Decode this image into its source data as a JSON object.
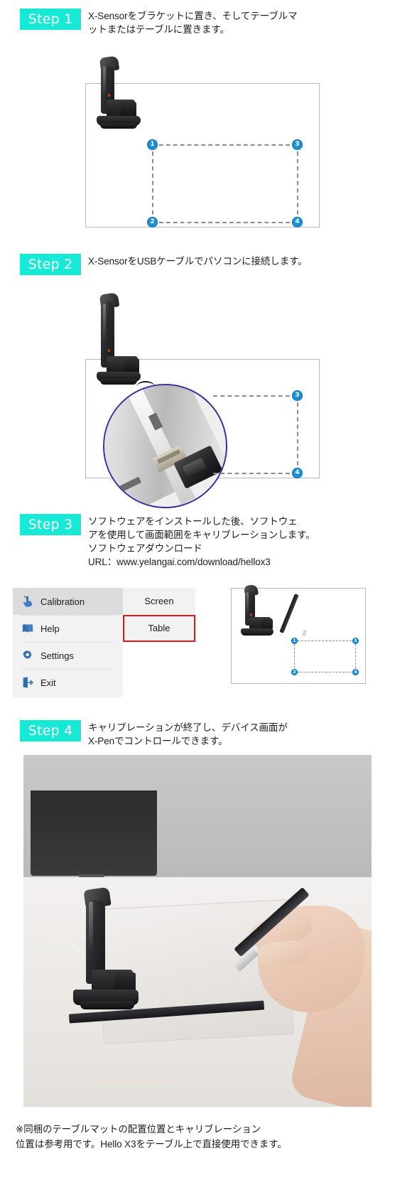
{
  "steps": [
    {
      "badge": "Step 1",
      "lines": [
        "X-Sensorをブラケットに置き、そしてテーブルマ",
        "ットまたはテーブルに置きます。"
      ]
    },
    {
      "badge": "Step 2",
      "lines": [
        "X-SensorをUSBケーブルでパソコンに接続します。"
      ]
    },
    {
      "badge": "Step 3",
      "lines": [
        "ソフトウェアをインストールした後、ソフトウェ",
        "アを使用して画面範囲をキャリブレーションします。",
        "ソフトウェアダウンロード",
        "URL：www.yelangai.com/download/hellox3"
      ]
    },
    {
      "badge": "Step 4",
      "lines": [
        "キャリブレーションが終了し、デバイス画面が",
        "X-Penでコントロールできます。"
      ]
    }
  ],
  "calibration_dots": {
    "one": "1",
    "two": "2",
    "three": "3",
    "four": "4"
  },
  "software_menu": {
    "items": [
      {
        "label": "Calibration",
        "icon": "touch-hand-icon",
        "selected": true
      },
      {
        "label": "Help",
        "icon": "book-icon",
        "selected": false
      },
      {
        "label": "Settings",
        "icon": "gear-icon",
        "selected": false
      },
      {
        "label": "Exit",
        "icon": "exit-door-icon",
        "selected": false
      }
    ],
    "modes": [
      {
        "label": "Screen",
        "highlighted": false
      },
      {
        "label": "Table",
        "highlighted": true
      }
    ]
  },
  "footer_note": {
    "lines": [
      "※同梱のテーブルマットの配置位置とキャリブレーション",
      "位置は参考用です。Hello X3をテーブル上で直接使用できます。"
    ]
  },
  "colors": {
    "badge_bg": "#17e9d7",
    "dot_blue": "#1a8fd6",
    "highlight_red": "#e11b1b",
    "magnifier_ring": "#3b2f9e",
    "menu_bg": "#f2f2f2",
    "menu_selected_bg": "#dcdcdc",
    "icon_blue": "#2b5fa8"
  }
}
